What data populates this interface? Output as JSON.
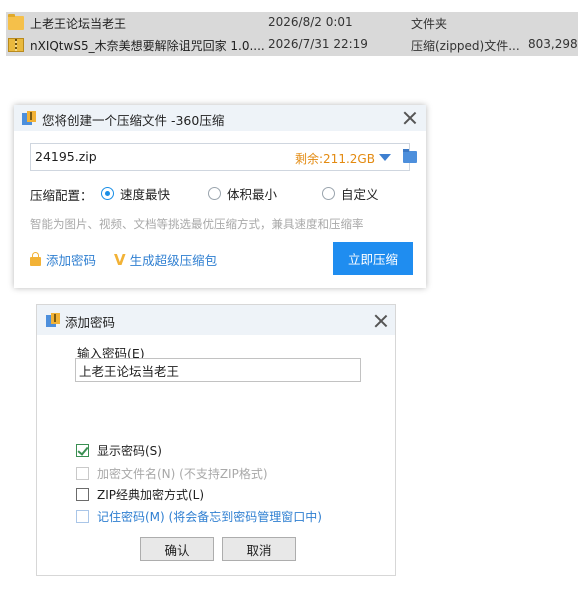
{
  "explorer": {
    "rows": [
      {
        "name": "上老王论坛当老王",
        "date": "2026/8/2 0:01",
        "type": "文件夹",
        "size": ""
      },
      {
        "name": "nXIQtwS5_木奈美想要解除诅咒回家 1.0....",
        "date": "2026/7/31 22:19",
        "type": "压缩(zipped)文件...",
        "size": "803,298"
      }
    ]
  },
  "compress_dialog": {
    "title": "您将创建一个压缩文件 -360压缩",
    "filename": "24195.zip",
    "free_space": "剩余:211.2GB",
    "config_label": "压缩配置：",
    "options": [
      "速度最快",
      "体积最小",
      "自定义"
    ],
    "selected_option": "速度最快",
    "hint": "智能为图片、视频、文档等挑选最优压缩方式，兼具速度和压缩率",
    "add_password_link": "添加密码",
    "super_package_link": "生成超级压缩包",
    "compress_button": "立即压缩",
    "accent_color": "#1f8df0"
  },
  "password_dialog": {
    "title": "添加密码",
    "input_label": "输入密码(E)",
    "password_value": "上老王论坛当老王",
    "checkboxes": [
      {
        "label": "显示密码(S)",
        "checked": true,
        "enabled": true
      },
      {
        "label": "加密文件名(N) (不支持ZIP格式)",
        "checked": false,
        "enabled": false
      },
      {
        "label": "ZIP经典加密方式(L)",
        "checked": false,
        "enabled": true
      },
      {
        "label": "记住密码(M) (将会备忘到密码管理窗口中)",
        "checked": false,
        "enabled": true
      }
    ],
    "ok_button": "确认",
    "cancel_button": "取消"
  }
}
